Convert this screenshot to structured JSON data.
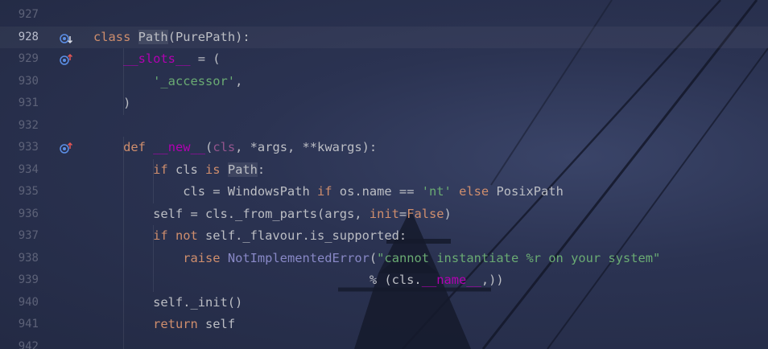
{
  "editor": {
    "lines": [
      {
        "num": "927",
        "tokens": []
      },
      {
        "num": "928",
        "current": true,
        "icon": "implemented-overridden-icon",
        "tokens": [
          {
            "t": "class ",
            "c": "kw"
          },
          {
            "t": "Path",
            "c": "cls hl"
          },
          {
            "t": "(PurePath):",
            "c": ""
          }
        ]
      },
      {
        "num": "929",
        "icon": "overrides-icon",
        "tokens": [
          {
            "t": "    ",
            "c": ""
          },
          {
            "t": "__slots__",
            "c": "dunder"
          },
          {
            "t": " = (",
            "c": ""
          }
        ]
      },
      {
        "num": "930",
        "tokens": [
          {
            "t": "        ",
            "c": ""
          },
          {
            "t": "'_accessor'",
            "c": "str"
          },
          {
            "t": ",",
            "c": ""
          }
        ]
      },
      {
        "num": "931",
        "tokens": [
          {
            "t": "    )",
            "c": ""
          }
        ]
      },
      {
        "num": "932",
        "tokens": []
      },
      {
        "num": "933",
        "icon": "overrides-icon",
        "tokens": [
          {
            "t": "    ",
            "c": ""
          },
          {
            "t": "def ",
            "c": "kw"
          },
          {
            "t": "__new__",
            "c": "dunder"
          },
          {
            "t": "(",
            "c": ""
          },
          {
            "t": "cls",
            "c": "param"
          },
          {
            "t": ", *args, **kwargs):",
            "c": ""
          }
        ]
      },
      {
        "num": "934",
        "tokens": [
          {
            "t": "        ",
            "c": ""
          },
          {
            "t": "if ",
            "c": "kw"
          },
          {
            "t": "cls ",
            "c": ""
          },
          {
            "t": "is ",
            "c": "kw"
          },
          {
            "t": "Path",
            "c": "hl"
          },
          {
            "t": ":",
            "c": ""
          }
        ]
      },
      {
        "num": "935",
        "tokens": [
          {
            "t": "            cls = WindowsPath ",
            "c": ""
          },
          {
            "t": "if ",
            "c": "kw"
          },
          {
            "t": "os.name == ",
            "c": ""
          },
          {
            "t": "'nt'",
            "c": "str"
          },
          {
            "t": " ",
            "c": ""
          },
          {
            "t": "else ",
            "c": "kw"
          },
          {
            "t": "PosixPath",
            "c": ""
          }
        ]
      },
      {
        "num": "936",
        "tokens": [
          {
            "t": "        self = cls._from_parts(args, ",
            "c": ""
          },
          {
            "t": "init",
            "c": "kw"
          },
          {
            "t": "=",
            "c": ""
          },
          {
            "t": "False",
            "c": "kw"
          },
          {
            "t": ")",
            "c": ""
          }
        ]
      },
      {
        "num": "937",
        "tokens": [
          {
            "t": "        ",
            "c": ""
          },
          {
            "t": "if not ",
            "c": "kw"
          },
          {
            "t": "self._flavour.is_supported:",
            "c": ""
          }
        ]
      },
      {
        "num": "938",
        "tokens": [
          {
            "t": "            ",
            "c": ""
          },
          {
            "t": "raise ",
            "c": "kw"
          },
          {
            "t": "NotImplementedError",
            "c": "builtin"
          },
          {
            "t": "(",
            "c": ""
          },
          {
            "t": "\"cannot instantiate %r on your system\"",
            "c": "str"
          }
        ]
      },
      {
        "num": "939",
        "tokens": [
          {
            "t": "                                     % (cls.",
            "c": ""
          },
          {
            "t": "__name__",
            "c": "dunder"
          },
          {
            "t": ",))",
            "c": ""
          }
        ]
      },
      {
        "num": "940",
        "tokens": [
          {
            "t": "        self._init()",
            "c": ""
          }
        ]
      },
      {
        "num": "941",
        "tokens": [
          {
            "t": "        ",
            "c": ""
          },
          {
            "t": "return ",
            "c": "kw"
          },
          {
            "t": "self",
            "c": ""
          }
        ]
      },
      {
        "num": "942",
        "tokens": []
      }
    ]
  },
  "colors": {
    "background": "#2b3352",
    "keyword": "#cf8e6d",
    "string": "#6aab73",
    "dunder": "#b200b2",
    "builtin": "#8888c6",
    "icon": "#5c8fe6",
    "icon_arrow_up": "#e05555"
  }
}
